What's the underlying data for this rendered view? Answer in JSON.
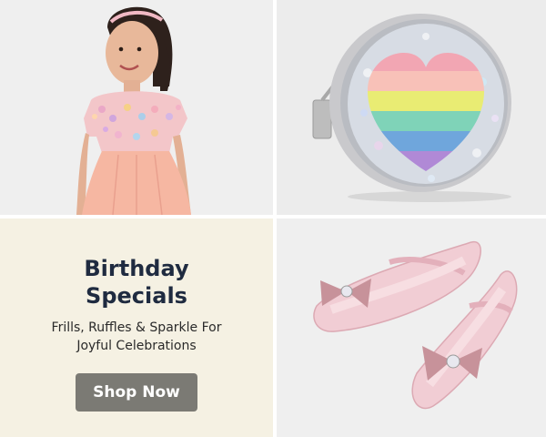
{
  "promo": {
    "title": "Birthday Specials",
    "subtitle": "Frills, Ruffles & Sparkle For Joyful Celebrations",
    "button_label": "Shop Now"
  },
  "tiles": [
    {
      "name": "girl-sequin-dress-photo"
    },
    {
      "name": "rainbow-heart-sequin-bag-photo"
    },
    {
      "name": "pink-bow-ballet-flats-photo"
    }
  ],
  "colors": {
    "promo_bg": "#f5f1e3",
    "title": "#1f2b40",
    "button_bg": "#7b7a74",
    "button_text": "#ffffff"
  }
}
